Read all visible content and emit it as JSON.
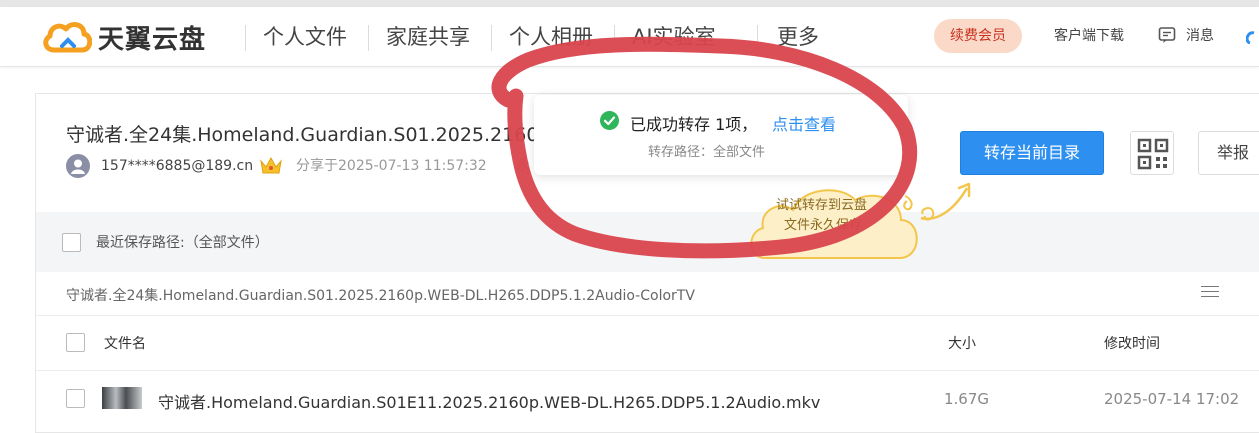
{
  "header": {
    "logo_text": "天翼云盘",
    "nav": [
      "个人文件",
      "家庭共享",
      "个人相册",
      "AI实验室",
      "更多"
    ],
    "vip_label": "续费会员",
    "client_download": "客户端下载",
    "messages": "消息"
  },
  "share": {
    "title": "守诚者.全24集.Homeland.Guardian.S01.2025.2160",
    "user": "157****6885@189.cn",
    "shared_at": "分享于2025-07-13 11:57:32",
    "expiry_fragment": "永",
    "save_button": "转存当前目录",
    "report_button": "举报"
  },
  "recent": {
    "label": "最近保存路径:（全部文件）"
  },
  "path": "守诚者.全24集.Homeland.Guardian.S01.2025.2160p.WEB-DL.H265.DDP5.1.2Audio-ColorTV",
  "table": {
    "columns": [
      "文件名",
      "大小",
      "修改时间"
    ],
    "rows": [
      {
        "name": "守诚者.Homeland.Guardian.S01E11.2025.2160p.WEB-DL.H265.DDP5.1.2Audio.mkv",
        "size": "1.67G",
        "modified": "2025-07-14 17:02"
      }
    ]
  },
  "toast": {
    "message": "已成功转存 1项，",
    "link": "点击查看",
    "sub": "转存路径：全部文件"
  },
  "tip_cloud": {
    "line1": "试试转存到云盘",
    "line2": "文件永久保存"
  },
  "colors": {
    "accent": "#2d8ff0",
    "vip_bg": "#fbd9c9",
    "vip_text": "#c7331e",
    "success": "#2fb55a",
    "annotation": "#d9454d"
  }
}
